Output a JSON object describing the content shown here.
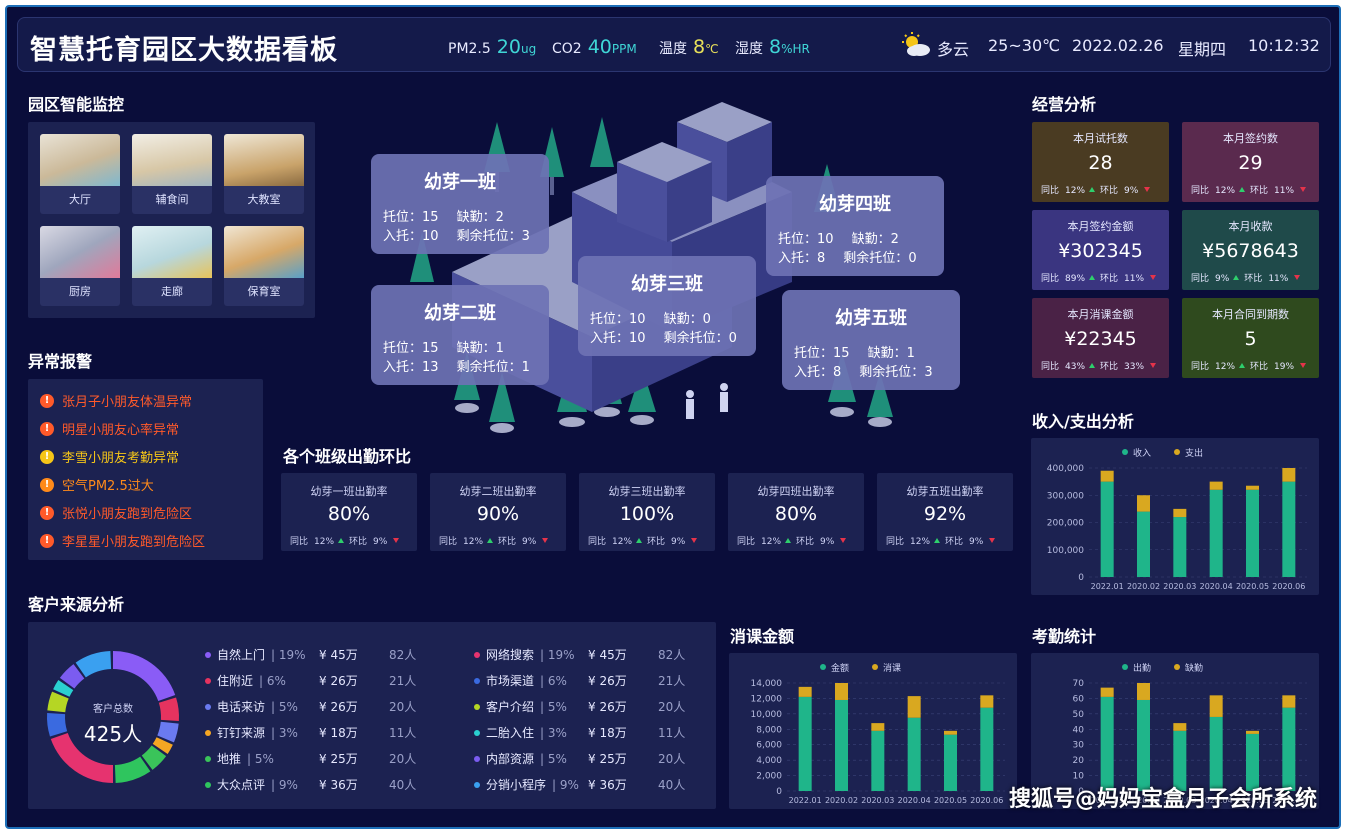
{
  "header": {
    "title": "智慧托育园区大数据看板",
    "pm25_label": "PM2.5",
    "pm25_value": "20",
    "pm25_unit": "ug",
    "co2_label": "CO2",
    "co2_value": "40",
    "co2_unit": "PPM",
    "temp_label": "温度",
    "temp_value": "8",
    "temp_unit": "℃",
    "hum_label": "湿度",
    "hum_value": "8",
    "hum_unit": "%HR",
    "weather": "多云",
    "temp_range": "25~30℃",
    "date": "2022.02.26",
    "weekday": "星期四",
    "time": "10:12:32"
  },
  "monitor": {
    "title": "园区智能监控",
    "cams": [
      "大厅",
      "辅食间",
      "大教室",
      "厨房",
      "走廊",
      "保育室"
    ]
  },
  "alarms": {
    "title": "异常报警",
    "items": [
      {
        "text": "张月子小朋友体温异常",
        "color": "#ff5a2a"
      },
      {
        "text": "明星小朋友心率异常",
        "color": "#ff5a2a"
      },
      {
        "text": "李雪小朋友考勤异常",
        "color": "#f5c518"
      },
      {
        "text": "空气PM2.5过大",
        "color": "#ff8a1a"
      },
      {
        "text": "张悦小朋友跑到危险区",
        "color": "#ff5a2a"
      },
      {
        "text": "李星星小朋友跑到危险区",
        "color": "#ff5a2a"
      }
    ]
  },
  "classes": [
    {
      "name": "幼芽一班",
      "tuowei": "15",
      "queqin": "2",
      "ruto": "10",
      "shengyu": "3"
    },
    {
      "name": "幼芽二班",
      "tuowei": "15",
      "queqin": "1",
      "ruto": "13",
      "shengyu": "1"
    },
    {
      "name": "幼芽三班",
      "tuowei": "10",
      "queqin": "0",
      "ruto": "10",
      "shengyu": "0"
    },
    {
      "name": "幼芽四班",
      "tuowei": "10",
      "queqin": "2",
      "ruto": "8",
      "shengyu": "0"
    },
    {
      "name": "幼芽五班",
      "tuowei": "15",
      "queqin": "1",
      "ruto": "8",
      "shengyu": "3"
    }
  ],
  "class_labels": {
    "tuowei": "托位：",
    "queqin": "缺勤：",
    "ruto": "入托：",
    "shengyu": "剩余托位："
  },
  "attendance": {
    "title": "各个班级出勤环比",
    "yoy_label": "同比",
    "mom_label": "环比",
    "cards": [
      {
        "label": "幼芽一班出勤率",
        "value": "80%",
        "yoy": "12%",
        "mom": "9%"
      },
      {
        "label": "幼芽二班出勤率",
        "value": "90%",
        "yoy": "12%",
        "mom": "9%"
      },
      {
        "label": "幼芽三班出勤率",
        "value": "100%",
        "yoy": "12%",
        "mom": "9%"
      },
      {
        "label": "幼芽四班出勤率",
        "value": "80%",
        "yoy": "12%",
        "mom": "9%"
      },
      {
        "label": "幼芽五班出勤率",
        "value": "92%",
        "yoy": "12%",
        "mom": "9%"
      }
    ]
  },
  "business": {
    "title": "经营分析",
    "yoy_label": "同比",
    "mom_label": "环比",
    "cards": [
      {
        "label": "本月试托数",
        "value": "28",
        "yoy": "12%",
        "mom": "9%",
        "bg": "#4a3b22"
      },
      {
        "label": "本月签约数",
        "value": "29",
        "yoy": "12%",
        "mom": "11%",
        "bg": "#5a2a4e"
      },
      {
        "label": "本月签约金额",
        "value": "¥302345",
        "yoy": "89%",
        "mom": "11%",
        "bg": "#3a3580"
      },
      {
        "label": "本月收款",
        "value": "¥5678643",
        "yoy": "9%",
        "mom": "11%",
        "bg": "#1f4a4a"
      },
      {
        "label": "本月消课金额",
        "value": "¥22345",
        "yoy": "43%",
        "mom": "33%",
        "bg": "#4a2246"
      },
      {
        "label": "本月合同到期数",
        "value": "5",
        "yoy": "12%",
        "mom": "19%",
        "bg": "#2f4a1e"
      }
    ]
  },
  "sources": {
    "title": "客户来源分析",
    "center_label": "客户总数",
    "center_value": "425人",
    "items": [
      {
        "name": "自然上门",
        "pct": "19%",
        "amt": "¥ 45万",
        "ppl": "82人",
        "color": "#8a5cf6"
      },
      {
        "name": "住附近",
        "pct": "6%",
        "amt": "¥ 26万",
        "ppl": "21人",
        "color": "#e6335f"
      },
      {
        "name": "电话来访",
        "pct": "5%",
        "amt": "¥ 26万",
        "ppl": "20人",
        "color": "#6a7af0"
      },
      {
        "name": "钉钉来源",
        "pct": "3%",
        "amt": "¥ 18万",
        "ppl": "11人",
        "color": "#f5a623"
      },
      {
        "name": "地推",
        "pct": "5%",
        "amt": "¥ 25万",
        "ppl": "20人",
        "color": "#3ac45a"
      },
      {
        "name": "大众点评",
        "pct": "9%",
        "amt": "¥ 36万",
        "ppl": "40人",
        "color": "#2fc55e"
      },
      {
        "name": "网络搜索",
        "pct": "19%",
        "amt": "¥ 45万",
        "ppl": "82人",
        "color": "#e6336f"
      },
      {
        "name": "市场渠道",
        "pct": "6%",
        "amt": "¥ 26万",
        "ppl": "21人",
        "color": "#3a6ae0"
      },
      {
        "name": "客户介绍",
        "pct": "5%",
        "amt": "¥ 26万",
        "ppl": "20人",
        "color": "#b5d624"
      },
      {
        "name": "二胎入住",
        "pct": "3%",
        "amt": "¥ 18万",
        "ppl": "11人",
        "color": "#2ad0d0"
      },
      {
        "name": "内部资源",
        "pct": "5%",
        "amt": "¥ 25万",
        "ppl": "20人",
        "color": "#7b5cf0"
      },
      {
        "name": "分销小程序",
        "pct": "9%",
        "amt": "¥ 36万",
        "ppl": "40人",
        "color": "#3aa0f0"
      }
    ]
  },
  "chart_data": [
    {
      "type": "bar",
      "title": "收入/支出分析",
      "categories": [
        "2022.01",
        "2020.02",
        "2020.03",
        "2020.04",
        "2020.05",
        "2020.06"
      ],
      "series": [
        {
          "name": "收入",
          "values": [
            350000,
            240000,
            220000,
            320000,
            320000,
            350000
          ],
          "color": "#1fb58a"
        },
        {
          "name": "支出",
          "values": [
            40000,
            60000,
            30000,
            30000,
            15000,
            50000
          ],
          "color": "#d9a820"
        }
      ],
      "yticks": [
        "400,000",
        "300,000",
        "200,000",
        "100,000",
        "0"
      ],
      "ylim": [
        0,
        400000
      ]
    },
    {
      "type": "bar",
      "title": "消课金额",
      "categories": [
        "2022.01",
        "2020.02",
        "2020.03",
        "2020.04",
        "2020.05",
        "2020.06"
      ],
      "series": [
        {
          "name": "金额",
          "values": [
            12200,
            11800,
            7800,
            9500,
            7300,
            10800
          ],
          "color": "#1fb58a"
        },
        {
          "name": "消课",
          "values": [
            1300,
            2200,
            1000,
            2800,
            500,
            1600
          ],
          "color": "#d9a820"
        }
      ],
      "yticks": [
        "14,000",
        "12,000",
        "10,000",
        "8,000",
        "6,000",
        "4,000",
        "2,000",
        "0"
      ],
      "ylim": [
        0,
        14000
      ]
    },
    {
      "type": "bar",
      "title": "考勤统计",
      "categories": [
        "2022.01",
        "2020.02",
        "2020.03",
        "2020.04",
        "2020.05",
        "2020.06"
      ],
      "series": [
        {
          "name": "出勤",
          "values": [
            61,
            59,
            39,
            48,
            37,
            54
          ],
          "color": "#1fb58a"
        },
        {
          "name": "缺勤",
          "values": [
            6,
            11,
            5,
            14,
            2,
            8
          ],
          "color": "#d9a820"
        }
      ],
      "yticks": [
        "70",
        "60",
        "50",
        "40",
        "30",
        "20",
        "10",
        "0"
      ],
      "ylim": [
        0,
        70
      ]
    }
  ],
  "watermark": "搜狐号@妈妈宝盒月子会所系统"
}
